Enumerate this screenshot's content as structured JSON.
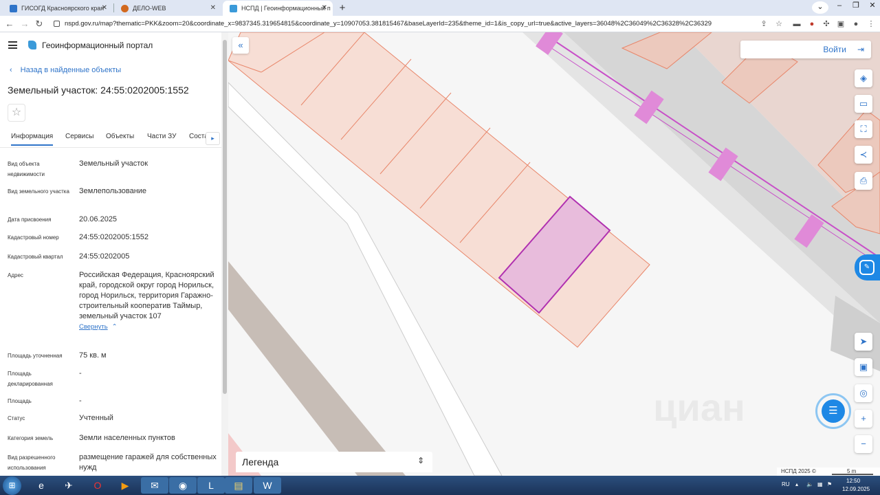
{
  "browser": {
    "tabs": [
      {
        "title": "ГИСОГД Красноярского края",
        "active": false,
        "favicon_color": "#2f74c9"
      },
      {
        "title": "ДЕЛО-WEB",
        "active": false,
        "favicon_color": "#d2691e"
      },
      {
        "title": "НСПД | Геоинформационный п",
        "active": true,
        "favicon_color": "#3b9ad9"
      }
    ],
    "url": "nspd.gov.ru/map?thematic=PKK&zoom=20&coordinate_x=9837345.319654815&coordinate_y=10907053.381815467&baseLayerId=235&theme_id=1&is_copy_url=true&active_layers=36048%2C36049%2C36328%2C36329"
  },
  "portal": {
    "title": "Геоинформационный портал",
    "back_link": "Назад в найденные объекты",
    "object_title": "Земельный участок: 24:55:0202005:1552",
    "tabs": [
      "Информация",
      "Сервисы",
      "Объекты",
      "Части ЗУ",
      "Соста"
    ],
    "fields": [
      {
        "label": "Вид объекта недвижимости",
        "value": "Земельный участок"
      },
      {
        "label": "Вид земельного участка",
        "value": "Землепользование"
      },
      {
        "label": "Дата присвоения",
        "value": "20.06.2025"
      },
      {
        "label": "Кадастровый номер",
        "value": "24:55:0202005:1552"
      },
      {
        "label": "Кадастровый квартал",
        "value": "24:55:0202005"
      },
      {
        "label": "Адрес",
        "value": "Российская Федерация, Красноярский край, городской округ город Норильск, город Норильск, территория Гаражно-строительный кооператив Таймыр, земельный участок 107"
      },
      {
        "label": "Площадь уточненная",
        "value": "75 кв. м"
      },
      {
        "label": "Площадь декларированная",
        "value": "-"
      },
      {
        "label": "Площадь",
        "value": "-"
      },
      {
        "label": "Статус",
        "value": "Учтенный"
      },
      {
        "label": "Категория земель",
        "value": "Земли населенных пунктов"
      },
      {
        "label": "Вид разрешенного использования",
        "value": "размещение гаражей для собственных нужд"
      }
    ],
    "collapse_label": "Свернуть"
  },
  "map": {
    "login_label": "Войти",
    "legend_label": "Легенда",
    "copyright": "НСПД 2025 ©",
    "scale_label": "5 m",
    "watermark": "циан"
  },
  "taskbar": {
    "lang": "RU",
    "time": "12:50",
    "date": "12.09.2025"
  }
}
